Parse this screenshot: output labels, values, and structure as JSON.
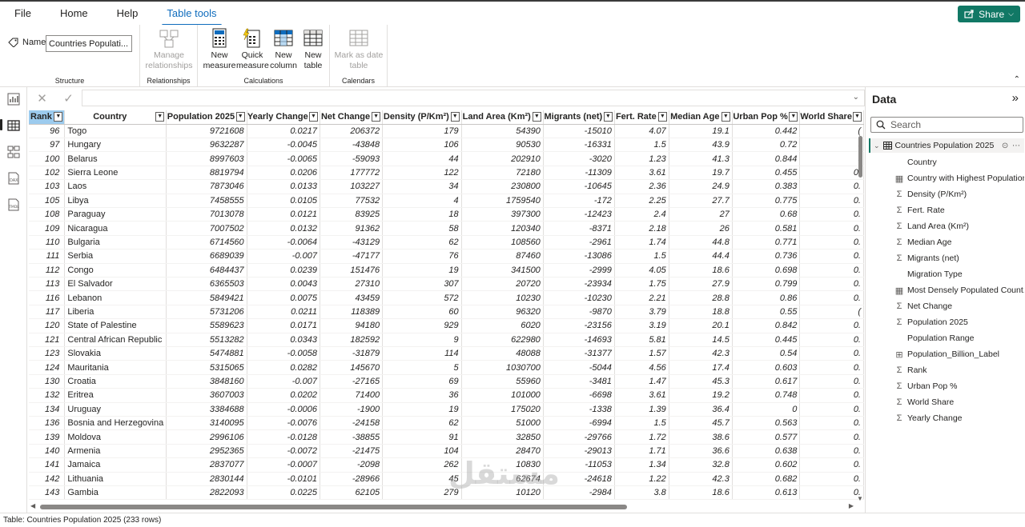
{
  "menu": {
    "file": "File",
    "home": "Home",
    "help": "Help",
    "table_tools": "Table tools",
    "share": "Share"
  },
  "ribbon": {
    "name_label": "Name",
    "name_value": "Countries Populati...",
    "structure_label": "Structure",
    "manage_rel_1": "Manage",
    "manage_rel_2": "relationships",
    "relationships_label": "Relationships",
    "new_measure_1": "New",
    "new_measure_2": "measure",
    "quick_measure_1": "Quick",
    "quick_measure_2": "measure",
    "new_column_1": "New",
    "new_column_2": "column",
    "new_table_1": "New",
    "new_table_2": "table",
    "calculations_label": "Calculations",
    "mark_date_1": "Mark as date",
    "mark_date_2": "table",
    "calendars_label": "Calendars"
  },
  "table": {
    "columns": [
      "Rank",
      "Country",
      "Population 2025",
      "Yearly Change",
      "Net Change",
      "Density (P/Km²)",
      "Land Area (Km²)",
      "Migrants (net)",
      "Fert. Rate",
      "Median Age",
      "Urban Pop %",
      "World Share"
    ],
    "rows": [
      [
        "96",
        "Togo",
        "9721608",
        "0.0217",
        "206372",
        "179",
        "54390",
        "-15010",
        "4.07",
        "19.1",
        "0.442",
        "("
      ],
      [
        "97",
        "Hungary",
        "9632287",
        "-0.0045",
        "-43848",
        "106",
        "90530",
        "-16331",
        "1.5",
        "43.9",
        "0.72",
        "("
      ],
      [
        "100",
        "Belarus",
        "8997603",
        "-0.0065",
        "-59093",
        "44",
        "202910",
        "-3020",
        "1.23",
        "41.3",
        "0.844",
        "("
      ],
      [
        "102",
        "Sierra Leone",
        "8819794",
        "0.0206",
        "177772",
        "122",
        "72180",
        "-11309",
        "3.61",
        "19.7",
        "0.455",
        "0."
      ],
      [
        "103",
        "Laos",
        "7873046",
        "0.0133",
        "103227",
        "34",
        "230800",
        "-10645",
        "2.36",
        "24.9",
        "0.383",
        "0."
      ],
      [
        "105",
        "Libya",
        "7458555",
        "0.0105",
        "77532",
        "4",
        "1759540",
        "-172",
        "2.25",
        "27.7",
        "0.775",
        "0."
      ],
      [
        "108",
        "Paraguay",
        "7013078",
        "0.0121",
        "83925",
        "18",
        "397300",
        "-12423",
        "2.4",
        "27",
        "0.68",
        "0."
      ],
      [
        "109",
        "Nicaragua",
        "7007502",
        "0.0132",
        "91362",
        "58",
        "120340",
        "-8371",
        "2.18",
        "26",
        "0.581",
        "0."
      ],
      [
        "110",
        "Bulgaria",
        "6714560",
        "-0.0064",
        "-43129",
        "62",
        "108560",
        "-2961",
        "1.74",
        "44.8",
        "0.771",
        "0."
      ],
      [
        "111",
        "Serbia",
        "6689039",
        "-0.007",
        "-47177",
        "76",
        "87460",
        "-13086",
        "1.5",
        "44.4",
        "0.736",
        "0."
      ],
      [
        "112",
        "Congo",
        "6484437",
        "0.0239",
        "151476",
        "19",
        "341500",
        "-2999",
        "4.05",
        "18.6",
        "0.698",
        "0."
      ],
      [
        "113",
        "El Salvador",
        "6365503",
        "0.0043",
        "27310",
        "307",
        "20720",
        "-23934",
        "1.75",
        "27.9",
        "0.799",
        "0."
      ],
      [
        "116",
        "Lebanon",
        "5849421",
        "0.0075",
        "43459",
        "572",
        "10230",
        "-10230",
        "2.21",
        "28.8",
        "0.86",
        "0."
      ],
      [
        "117",
        "Liberia",
        "5731206",
        "0.0211",
        "118389",
        "60",
        "96320",
        "-9870",
        "3.79",
        "18.8",
        "0.55",
        "("
      ],
      [
        "120",
        "State of Palestine",
        "5589623",
        "0.0171",
        "94180",
        "929",
        "6020",
        "-23156",
        "3.19",
        "20.1",
        "0.842",
        "0."
      ],
      [
        "121",
        "Central African Republic",
        "5513282",
        "0.0343",
        "182592",
        "9",
        "622980",
        "-14693",
        "5.81",
        "14.5",
        "0.445",
        "0."
      ],
      [
        "123",
        "Slovakia",
        "5474881",
        "-0.0058",
        "-31879",
        "114",
        "48088",
        "-31377",
        "1.57",
        "42.3",
        "0.54",
        "0."
      ],
      [
        "124",
        "Mauritania",
        "5315065",
        "0.0282",
        "145670",
        "5",
        "1030700",
        "-5044",
        "4.56",
        "17.4",
        "0.603",
        "0."
      ],
      [
        "130",
        "Croatia",
        "3848160",
        "-0.007",
        "-27165",
        "69",
        "55960",
        "-3481",
        "1.47",
        "45.3",
        "0.617",
        "0."
      ],
      [
        "132",
        "Eritrea",
        "3607003",
        "0.0202",
        "71400",
        "36",
        "101000",
        "-6698",
        "3.61",
        "19.2",
        "0.748",
        "0."
      ],
      [
        "134",
        "Uruguay",
        "3384688",
        "-0.0006",
        "-1900",
        "19",
        "175020",
        "-1338",
        "1.39",
        "36.4",
        "0",
        "0."
      ],
      [
        "136",
        "Bosnia and Herzegovina",
        "3140095",
        "-0.0076",
        "-24158",
        "62",
        "51000",
        "-6994",
        "1.5",
        "45.7",
        "0.563",
        "0."
      ],
      [
        "139",
        "Moldova",
        "2996106",
        "-0.0128",
        "-38855",
        "91",
        "32850",
        "-29766",
        "1.72",
        "38.6",
        "0.577",
        "0."
      ],
      [
        "140",
        "Armenia",
        "2952365",
        "-0.0072",
        "-21475",
        "104",
        "28470",
        "-29013",
        "1.71",
        "36.6",
        "0.638",
        "0."
      ],
      [
        "141",
        "Jamaica",
        "2837077",
        "-0.0007",
        "-2098",
        "262",
        "10830",
        "-11053",
        "1.34",
        "32.8",
        "0.602",
        "0."
      ],
      [
        "142",
        "Lithuania",
        "2830144",
        "-0.0101",
        "-28966",
        "45",
        "62674",
        "-24618",
        "1.22",
        "42.3",
        "0.682",
        "0."
      ],
      [
        "143",
        "Gambia",
        "2822093",
        "0.0225",
        "62105",
        "279",
        "10120",
        "-2984",
        "3.8",
        "18.6",
        "0.613",
        "0."
      ]
    ]
  },
  "status": "Table: Countries Population 2025 (233 rows)",
  "data_pane": {
    "title": "Data",
    "search_placeholder": "Search",
    "table_name": "Countries Population 2025",
    "fields": [
      {
        "icon": "none",
        "label": "Country"
      },
      {
        "icon": "calc",
        "label": "Country with Highest Population"
      },
      {
        "icon": "sigma",
        "label": "Density (P/Km²)"
      },
      {
        "icon": "sigma",
        "label": "Fert. Rate"
      },
      {
        "icon": "sigma",
        "label": "Land Area (Km²)"
      },
      {
        "icon": "sigma",
        "label": "Median Age"
      },
      {
        "icon": "sigma",
        "label": "Migrants (net)"
      },
      {
        "icon": "none",
        "label": "Migration Type"
      },
      {
        "icon": "calc",
        "label": "Most Densely Populated Count..."
      },
      {
        "icon": "sigma",
        "label": "Net Change"
      },
      {
        "icon": "sigma",
        "label": "Population 2025"
      },
      {
        "icon": "none",
        "label": "Population Range"
      },
      {
        "icon": "calccol",
        "label": "Population_Billion_Label"
      },
      {
        "icon": "sigma",
        "label": "Rank"
      },
      {
        "icon": "sigma",
        "label": "Urban Pop %"
      },
      {
        "icon": "sigma",
        "label": "World Share"
      },
      {
        "icon": "sigma",
        "label": "Yearly Change"
      }
    ]
  },
  "watermark": "مستقل"
}
